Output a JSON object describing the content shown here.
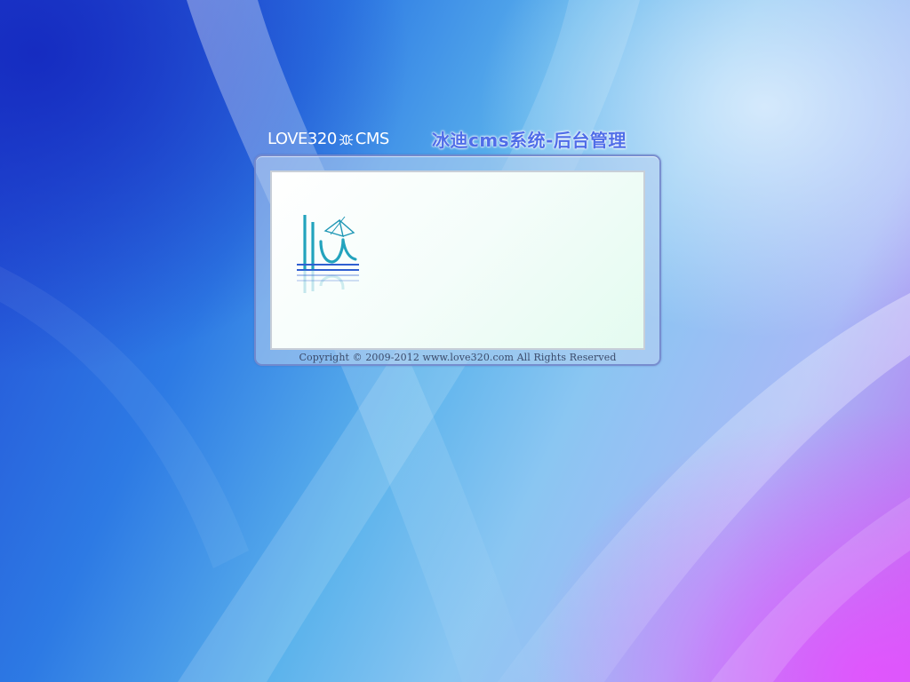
{
  "login": {
    "brand_left": "LOVE320",
    "brand_right": "CMS",
    "system_title": "冰迪cms系统-后台管理",
    "copyright": "Copyright © 2009-2012 www.love320.com All Rights Reserved"
  },
  "colors": {
    "title_accent": "#4f6de8",
    "frame_border": "#6e82c8",
    "panel_background": "#f4fdfa"
  },
  "icons": {
    "brand_separator": "bug-icon",
    "panel_logo": "lu-logo-icon"
  }
}
